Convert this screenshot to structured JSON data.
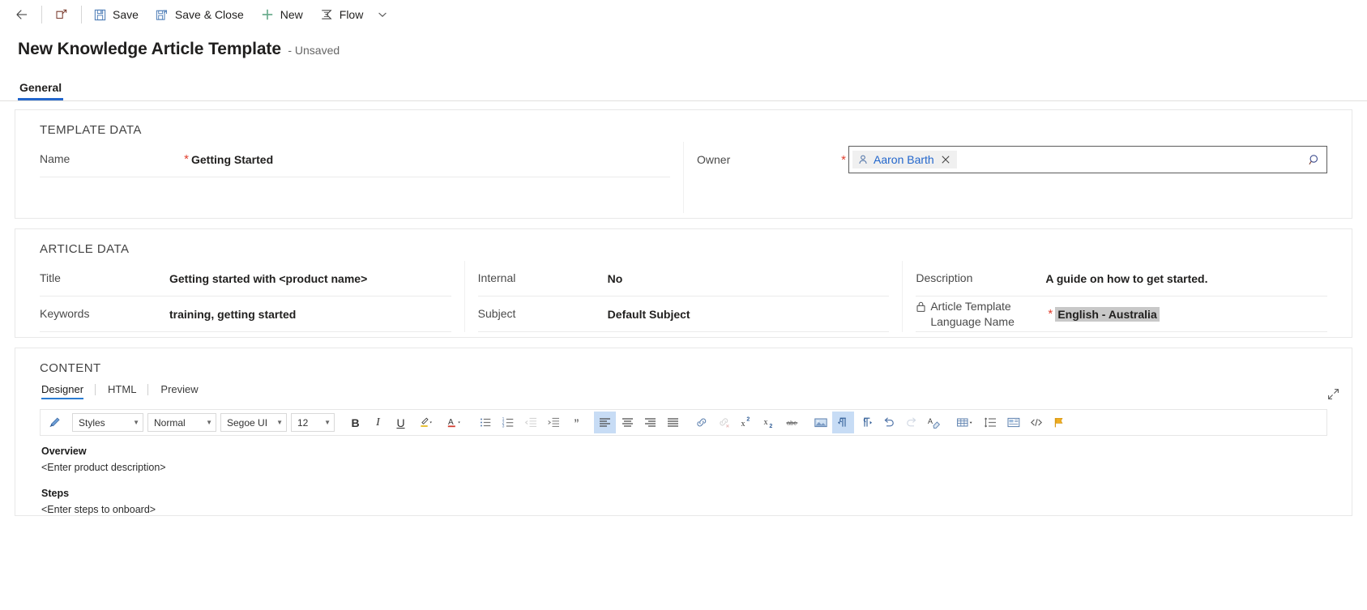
{
  "command_bar": {
    "back_icon": "arrow-left-icon",
    "popout_icon": "open-in-new-window-icon",
    "buttons": [
      {
        "label": "Save",
        "icon": "save-icon"
      },
      {
        "label": "Save & Close",
        "icon": "save-and-close-icon"
      },
      {
        "label": "New",
        "icon": "plus-icon"
      },
      {
        "label": "Flow",
        "icon": "flow-icon"
      }
    ],
    "overflow_icon": "chevron-down-icon"
  },
  "header": {
    "title": "New Knowledge Article Template",
    "subtitle": "- Unsaved"
  },
  "tabs": [
    {
      "label": "General",
      "active": true
    }
  ],
  "template_data": {
    "section_title": "TEMPLATE DATA",
    "name": {
      "label": "Name",
      "required": true,
      "value": "Getting Started"
    },
    "owner": {
      "label": "Owner",
      "required": true,
      "pill_name": "Aaron Barth",
      "pill_icon": "person-icon",
      "remove_icon": "close-icon",
      "search_icon": "search-icon"
    }
  },
  "article_data": {
    "section_title": "ARTICLE DATA",
    "rows": [
      {
        "label": "Title",
        "value": "Getting started with <product name>",
        "required": false
      },
      {
        "label": "Keywords",
        "value": "training, getting started",
        "required": false
      },
      {
        "label": "Internal",
        "value": "No",
        "required": false
      },
      {
        "label": "Subject",
        "value": "Default Subject",
        "required": false
      },
      {
        "label": "Description",
        "value": "A guide on how to get started.",
        "required": false
      },
      {
        "label": "Article Template Language Name",
        "value": "English - Australia",
        "required": true,
        "locked": true,
        "lock_icon": "lock-icon",
        "highlighted": true
      }
    ]
  },
  "content": {
    "section_title": "CONTENT",
    "editor_tabs": [
      {
        "label": "Designer",
        "active": true
      },
      {
        "label": "HTML",
        "active": false
      },
      {
        "label": "Preview",
        "active": false
      }
    ],
    "expand_icon": "expand-diagonal-icon",
    "toolbar": {
      "format_painter_icon": "format-painter-icon",
      "styles_select": {
        "value": "Styles",
        "name": "styles-select"
      },
      "paragraph_select": {
        "value": "Normal",
        "name": "paragraph-format-select"
      },
      "font_select": {
        "value": "Segoe UI",
        "name": "font-family-select"
      },
      "size_select": {
        "value": "12",
        "name": "font-size-select"
      },
      "buttons": [
        {
          "name": "bold-button",
          "glyph": "B",
          "active": false
        },
        {
          "name": "italic-button",
          "glyph": "I",
          "active": false
        },
        {
          "name": "underline-button",
          "glyph": "U",
          "active": false
        },
        {
          "name": "highlight-color-button",
          "glyph": "highlighter-icon",
          "active": false
        },
        {
          "name": "font-color-button",
          "glyph": "font-color-icon",
          "active": false
        },
        {
          "name": "bulleted-list-button",
          "glyph": "bulleted-list-icon",
          "active": false
        },
        {
          "name": "numbered-list-button",
          "glyph": "numbered-list-icon",
          "active": false
        },
        {
          "name": "decrease-indent-button",
          "glyph": "decrease-indent-icon",
          "active": false,
          "disabled": true
        },
        {
          "name": "increase-indent-button",
          "glyph": "increase-indent-icon",
          "active": false
        },
        {
          "name": "blockquote-button",
          "glyph": "quote-icon",
          "active": false
        },
        {
          "name": "align-left-button",
          "glyph": "align-left-icon",
          "active": true
        },
        {
          "name": "align-center-button",
          "glyph": "align-center-icon",
          "active": false
        },
        {
          "name": "align-right-button",
          "glyph": "align-right-icon",
          "active": false
        },
        {
          "name": "justify-button",
          "glyph": "justify-icon",
          "active": false
        },
        {
          "name": "insert-link-button",
          "glyph": "link-icon",
          "active": false
        },
        {
          "name": "remove-link-button",
          "glyph": "unlink-icon",
          "active": false,
          "disabled": true
        },
        {
          "name": "superscript-button",
          "glyph": "superscript-icon",
          "active": false
        },
        {
          "name": "subscript-button",
          "glyph": "subscript-icon",
          "active": false
        },
        {
          "name": "strikethrough-button",
          "glyph": "strikethrough-icon",
          "active": false
        },
        {
          "name": "insert-image-button",
          "glyph": "image-icon",
          "active": false
        },
        {
          "name": "left-to-right-button",
          "glyph": "ltr-paragraph-icon",
          "active": true
        },
        {
          "name": "right-to-left-button",
          "glyph": "rtl-paragraph-icon",
          "active": false
        },
        {
          "name": "undo-button",
          "glyph": "undo-icon",
          "active": false
        },
        {
          "name": "redo-button",
          "glyph": "redo-icon",
          "active": false,
          "disabled": true
        },
        {
          "name": "clear-formatting-button",
          "glyph": "clear-format-icon",
          "active": false
        },
        {
          "name": "insert-table-button",
          "glyph": "table-icon",
          "active": false
        },
        {
          "name": "line-spacing-button",
          "glyph": "line-spacing-icon",
          "active": false
        },
        {
          "name": "insert-template-button",
          "glyph": "insert-template-icon",
          "active": false
        },
        {
          "name": "source-code-button",
          "glyph": "code-icon",
          "active": false
        },
        {
          "name": "flag-button",
          "glyph": "flag-icon",
          "active": false
        }
      ]
    },
    "body": [
      {
        "type": "heading",
        "text": "Overview"
      },
      {
        "type": "paragraph",
        "text": "<Enter product description>"
      },
      {
        "type": "heading",
        "text": "Steps"
      },
      {
        "type": "paragraph",
        "text": "<Enter steps to onboard>"
      }
    ]
  },
  "colors": {
    "accent": "#2266cc",
    "required": "#e03e2d",
    "toolbar_active": "#c7dcf5",
    "highlight": "#c8c8c8"
  }
}
